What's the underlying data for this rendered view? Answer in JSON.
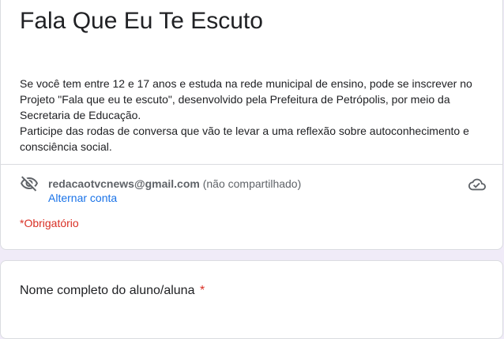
{
  "form": {
    "title": "Fala Que Eu Te Escuto",
    "description_lines": [
      "Se você tem entre 12 e 17 anos e estuda na rede municipal de ensino, pode se inscrever no Projeto \"Fala que eu te escuto\", desenvolvido pela Prefeitura de Petrópolis, por meio da Secretaria de Educação.",
      "Participe das rodas de conversa que vão te levar a uma reflexão sobre autoconhecimento e consciência social."
    ]
  },
  "account": {
    "email": "redacaotvcnews@gmail.com",
    "share_note": "(não compartilhado)",
    "switch_label": "Alternar conta",
    "icons": {
      "privacy": "eye-off-icon",
      "save": "cloud-done-icon"
    }
  },
  "required_note": "*Obrigatório",
  "questions": [
    {
      "title": "Nome completo do aluno/aluna",
      "required_marker": "*"
    }
  ],
  "colors": {
    "background": "#f0ebf8",
    "link": "#1a73e8",
    "required": "#d93025",
    "muted": "#5f6368"
  }
}
